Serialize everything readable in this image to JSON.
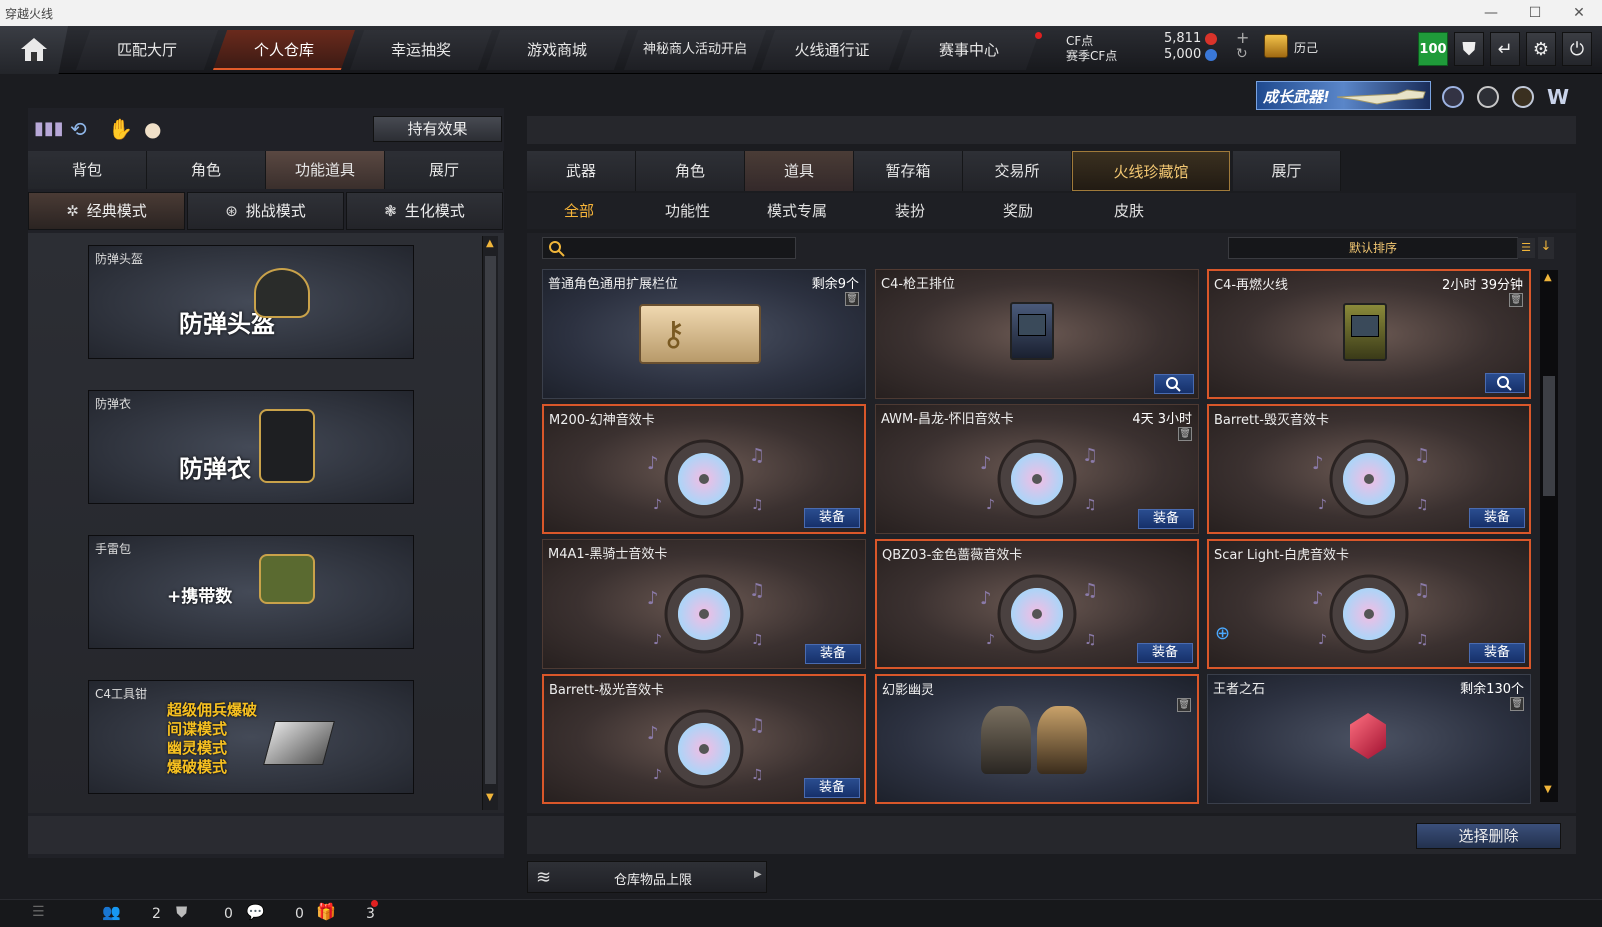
{
  "window": {
    "title": "穿越火线"
  },
  "nav": {
    "tabs": [
      "匹配大厅",
      "个人仓库",
      "幸运抽奖",
      "游戏商城",
      "神秘商人活动开启",
      "火线通行证",
      "赛事中心"
    ],
    "active_index": 1,
    "cf_label": "CF点",
    "season_label": "赛季CF点",
    "cf_value": "5,811",
    "season_value": "5,000",
    "rank_label": "历己",
    "badge_value": "100"
  },
  "banner": {
    "text": "成长武器!"
  },
  "left": {
    "hold_effect_label": "持有效果",
    "tabs": [
      "背包",
      "角色",
      "功能道具",
      "展厅"
    ],
    "active_tab": 2,
    "modes": [
      "经典模式",
      "挑战模式",
      "生化模式"
    ],
    "cards": [
      {
        "label": "防弹头盔",
        "big": "防弹头盔"
      },
      {
        "label": "防弹衣",
        "big": "防弹衣"
      },
      {
        "label": "手雷包",
        "big": "+携带数"
      },
      {
        "label": "C4工具钳",
        "lines": [
          "超级佣兵爆破",
          "间谍模式",
          "幽灵模式",
          "爆破模式"
        ]
      }
    ]
  },
  "right": {
    "tabs": [
      "武器",
      "角色",
      "道具",
      "暂存箱",
      "交易所",
      "火线珍藏馆",
      "展厅"
    ],
    "active_tab": 2,
    "special_tab": 5,
    "subtabs": [
      "全部",
      "功能性",
      "模式专属",
      "装扮",
      "奖励",
      "皮肤"
    ],
    "active_subtab": 0,
    "search_placeholder": "",
    "sort_label": "默认排序",
    "equip_label": "装备",
    "items": [
      {
        "name": "普通角色通用扩展栏位",
        "meta": "剩余9个",
        "type": "key",
        "style": "blue",
        "lock": true
      },
      {
        "name": "C4-枪王排位",
        "meta": "",
        "type": "c4",
        "style": "brown",
        "lock": false,
        "search": true
      },
      {
        "name": "C4-再燃火线",
        "meta": "2小时 39分钟",
        "type": "c4b",
        "style": "brown",
        "lock": true,
        "search": true,
        "selected": true
      },
      {
        "name": "M200-幻神音效卡",
        "meta": "",
        "type": "disc",
        "style": "brown",
        "equip": true,
        "selected": true
      },
      {
        "name": "AWM-昌龙-怀旧音效卡",
        "meta": "4天 3小时",
        "type": "disc",
        "style": "brown",
        "lock": true,
        "equip": true
      },
      {
        "name": "Barrett-毁灭音效卡",
        "meta": "",
        "type": "disc",
        "style": "brown",
        "equip": true,
        "selected": true
      },
      {
        "name": "M4A1-黑骑士音效卡",
        "meta": "",
        "type": "disc",
        "style": "brown",
        "equip": true
      },
      {
        "name": "QBZ03-金色蔷薇音效卡",
        "meta": "",
        "type": "disc",
        "style": "brown",
        "equip": true,
        "selected": true
      },
      {
        "name": "Scar Light-白虎音效卡",
        "meta": "",
        "type": "disc",
        "style": "brown",
        "equip": true,
        "selected": true
      },
      {
        "name": "Barrett-极光音效卡",
        "meta": "",
        "type": "disc",
        "style": "brown",
        "equip": true,
        "selected": true
      },
      {
        "name": "幻影幽灵",
        "meta": "",
        "type": "ghost",
        "style": "blue",
        "lock": true,
        "selected": true
      },
      {
        "name": "王者之石",
        "meta": "剩余130个",
        "type": "gem",
        "style": "blue",
        "lock": true
      }
    ],
    "delete_label": "选择删除",
    "storage_label": "仓库物品上限"
  },
  "statusbar": {
    "counts": [
      "2",
      "0",
      "0",
      "3"
    ]
  }
}
